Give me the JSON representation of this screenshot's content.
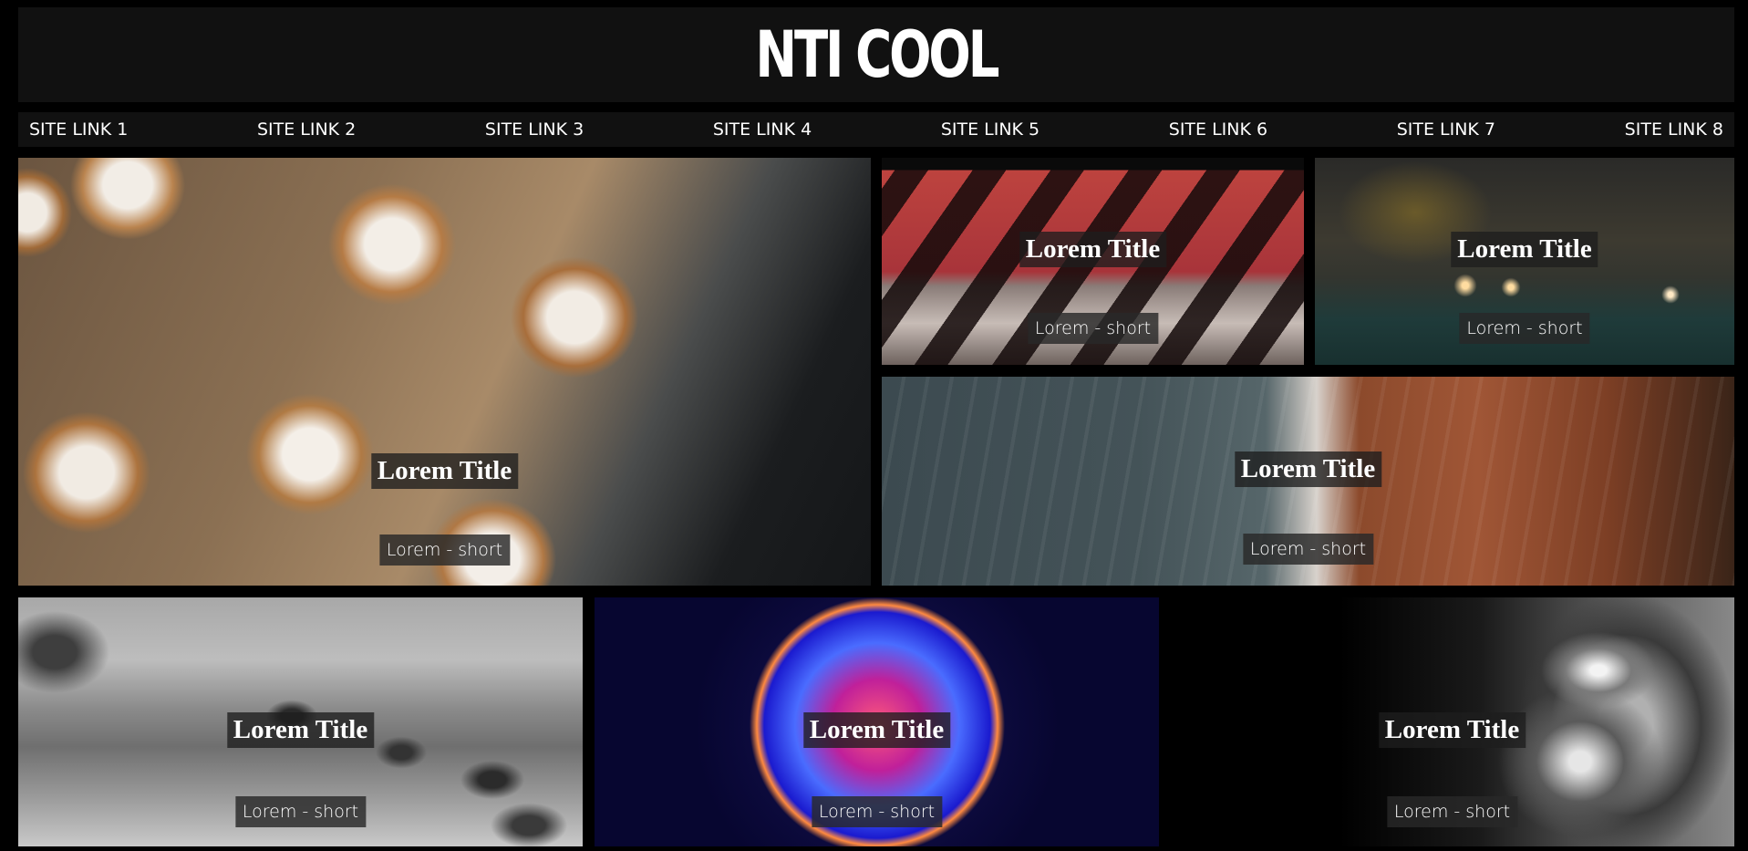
{
  "header": {
    "title": "NTI COOL"
  },
  "nav": {
    "links": [
      "SITE LINK 1",
      "SITE LINK 2",
      "SITE LINK 3",
      "SITE LINK 4",
      "SITE LINK 5",
      "SITE LINK 6",
      "SITE LINK 7",
      "SITE LINK 8"
    ]
  },
  "tiles": [
    {
      "title": "Lorem Title",
      "subtitle": "Lorem - short",
      "image": "cinnamon-buns"
    },
    {
      "title": "Lorem Title",
      "subtitle": "Lorem - short",
      "image": "red-wall-shadows"
    },
    {
      "title": "Lorem Title",
      "subtitle": "Lorem - short",
      "image": "night-street"
    },
    {
      "title": "Lorem Title",
      "subtitle": "Lorem - short",
      "image": "ocean-shore"
    },
    {
      "title": "Lorem Title",
      "subtitle": "Lorem - short",
      "image": "rocky-shore-bw"
    },
    {
      "title": "Lorem Title",
      "subtitle": "Lorem - short",
      "image": "glowing-sphere"
    },
    {
      "title": "Lorem Title",
      "subtitle": "Lorem - short",
      "image": "chrome-statue"
    }
  ]
}
